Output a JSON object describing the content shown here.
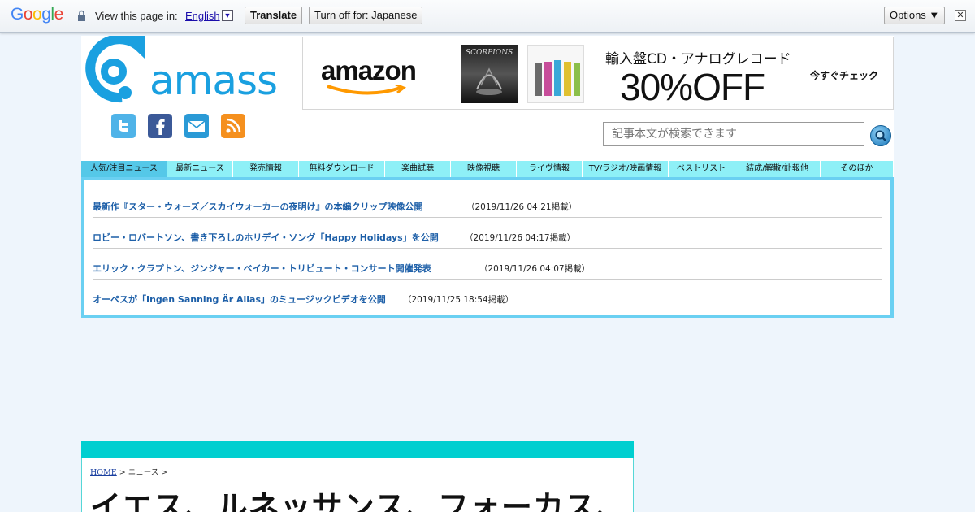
{
  "translate_bar": {
    "logo_letters": [
      {
        "char": "G",
        "color": "#4285f4"
      },
      {
        "char": "o",
        "color": "#ea4335"
      },
      {
        "char": "o",
        "color": "#fbbc05"
      },
      {
        "char": "g",
        "color": "#4285f4"
      },
      {
        "char": "l",
        "color": "#34a853"
      },
      {
        "char": "e",
        "color": "#ea4335"
      }
    ],
    "view_text": "View this page in:",
    "language": "English",
    "dropdown_glyph": "▼",
    "translate_label": "Translate",
    "turn_off_label": "Turn off for: Japanese",
    "options_label": "Options ▼",
    "close_glyph": "✕"
  },
  "header": {
    "logo_text": "amass",
    "social_icons": [
      "twitter-icon",
      "facebook-icon",
      "mail-icon",
      "rss-icon"
    ],
    "banner": {
      "brand": "amazon",
      "cd1_title": "SCORPIONS",
      "subtitle": "輸入盤CD・アナログレコード",
      "headline": "30%OFF",
      "cta": "今すぐチェック"
    },
    "search_placeholder": "記事本文が検索できます"
  },
  "nav": {
    "items": [
      {
        "label": "人気/注目ニュース",
        "active": true
      },
      {
        "label": "最新ニュース",
        "active": false
      },
      {
        "label": "発売情報",
        "active": false
      },
      {
        "label": "無料ダウンロード",
        "active": false
      },
      {
        "label": "楽曲試聴",
        "active": false
      },
      {
        "label": "映像視聴",
        "active": false
      },
      {
        "label": "ライヴ情報",
        "active": false
      },
      {
        "label": "TV/ラジオ/映画情報",
        "active": false
      },
      {
        "label": "ベストリスト",
        "active": false
      },
      {
        "label": "結成/解散/訃報他",
        "active": false
      },
      {
        "label": "そのほか",
        "active": false
      }
    ]
  },
  "news": {
    "items": [
      {
        "title": "最新作『スター・ウォーズ／スカイウォーカーの夜明け』の本編クリップ映像公開",
        "date": "（2019/11/26 04:21掲載）"
      },
      {
        "title": "ロビー・ロバートソン、書き下ろしのホリデイ・ソング「Happy Holidays」を公開",
        "date": "（2019/11/26 04:17掲載）"
      },
      {
        "title": "エリック・クラプトン、ジンジャー・ベイカー・トリビュート・コンサート開催発表",
        "date": "（2019/11/26 04:07掲載）"
      },
      {
        "title": "オーペスが「Ingen Sanning Är Allas」のミュージックビデオを公開",
        "date": "（2019/11/25 18:54掲載）"
      }
    ]
  },
  "article": {
    "breadcrumb_home": "HOME",
    "breadcrumb_rest": " > ニュース > ",
    "headline": "イエス、ルネッサンス、フォーカス、"
  }
}
